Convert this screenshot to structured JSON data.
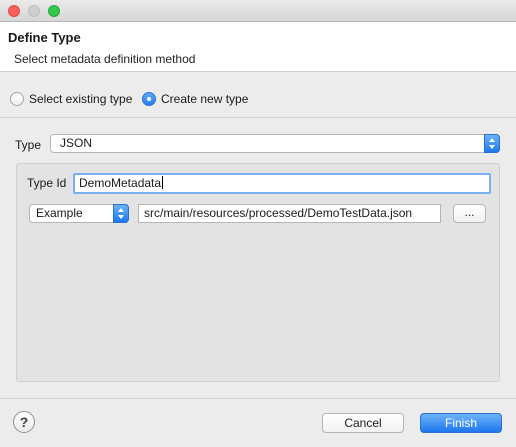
{
  "dialog": {
    "title": "Define Type",
    "subtitle": "Select metadata definition method"
  },
  "method": {
    "existing_label": "Select existing type",
    "new_label": "Create new type",
    "selected": "new"
  },
  "type_field": {
    "label": "Type",
    "value": "JSON"
  },
  "type_id": {
    "label": "Type Id",
    "value": "DemoMetadata"
  },
  "source": {
    "mode": "Example",
    "path": "src/main/resources/processed/DemoTestData.json",
    "browse_label": "..."
  },
  "footer": {
    "help_label": "?",
    "cancel_label": "Cancel",
    "finish_label": "Finish"
  },
  "colors": {
    "accent": "#2a7ef0",
    "focus_ring": "#7aaef0"
  }
}
